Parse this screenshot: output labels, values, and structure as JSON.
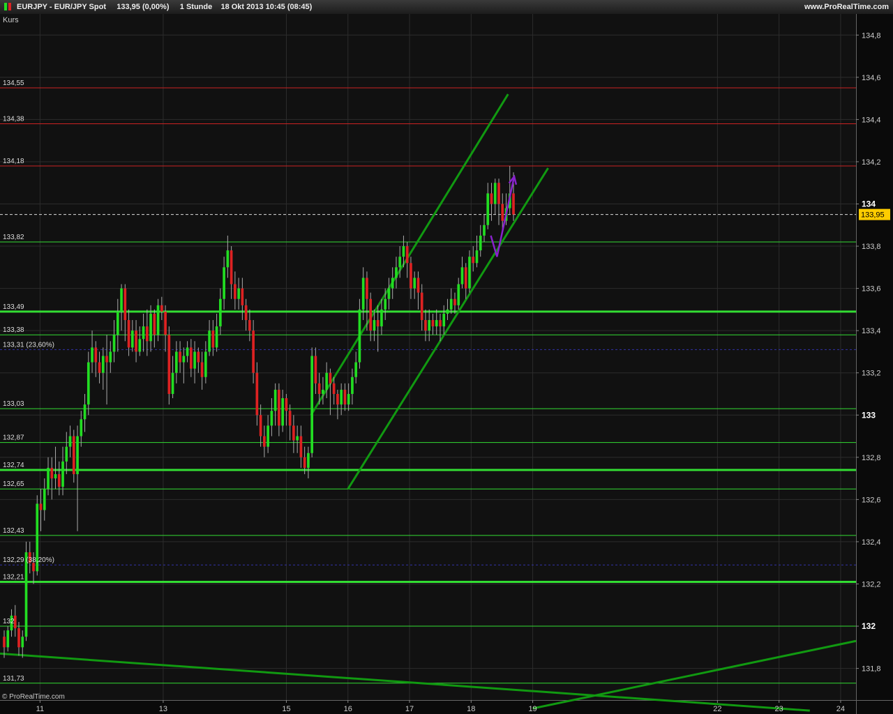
{
  "header": {
    "symbol": "EURJPY",
    "instrument": "EUR/JPY Spot",
    "price": "133,95 (0,00%)",
    "timeframe": "1 Stunde",
    "datetime": "18 Okt 2013 10:45 (08:45)",
    "website": "www.ProRealTime.com"
  },
  "footer": {
    "copyright": "© ProRealTime.com"
  },
  "colors": {
    "background": "#111111",
    "up_candle": "#22dd22",
    "down_candle": "#dd2222",
    "resistance_line": "#cc2222",
    "support_line": "#33dd33",
    "channel_line": "#119911",
    "fib_line": "#3333aa",
    "forecast_arrow": "#8822cc",
    "price_marker": "#ffcc00"
  },
  "chart_data": {
    "type": "candlestick",
    "panel_label": "Kurs",
    "ylim": [
      131.65,
      134.9
    ],
    "xlim": [
      10.35,
      24.25
    ],
    "y_ticks": [
      {
        "value": 131.8,
        "label": "131,8",
        "bold": false
      },
      {
        "value": 132.0,
        "label": "132",
        "bold": true
      },
      {
        "value": 132.2,
        "label": "132,2",
        "bold": false
      },
      {
        "value": 132.4,
        "label": "132,4",
        "bold": false
      },
      {
        "value": 132.6,
        "label": "132,6",
        "bold": false
      },
      {
        "value": 132.8,
        "label": "132,8",
        "bold": false
      },
      {
        "value": 133.0,
        "label": "133",
        "bold": true
      },
      {
        "value": 133.2,
        "label": "133,2",
        "bold": false
      },
      {
        "value": 133.4,
        "label": "133,4",
        "bold": false
      },
      {
        "value": 133.6,
        "label": "133,6",
        "bold": false
      },
      {
        "value": 133.8,
        "label": "133,8",
        "bold": false
      },
      {
        "value": 134.0,
        "label": "134",
        "bold": true
      },
      {
        "value": 134.2,
        "label": "134,2",
        "bold": false
      },
      {
        "value": 134.4,
        "label": "134,4",
        "bold": false
      },
      {
        "value": 134.6,
        "label": "134,6",
        "bold": false
      },
      {
        "value": 134.8,
        "label": "134,8",
        "bold": false
      }
    ],
    "x_ticks": [
      {
        "value": 11,
        "label": "11"
      },
      {
        "value": 13,
        "label": "13"
      },
      {
        "value": 15,
        "label": "15"
      },
      {
        "value": 16,
        "label": "16"
      },
      {
        "value": 17,
        "label": "17"
      },
      {
        "value": 18,
        "label": "18"
      },
      {
        "value": 19,
        "label": "19"
      },
      {
        "value": 22,
        "label": "22"
      },
      {
        "value": 23,
        "label": "23"
      },
      {
        "value": 24,
        "label": "24"
      }
    ],
    "last_price": {
      "value": 133.95,
      "label": "133,95"
    },
    "levels": [
      {
        "value": 134.55,
        "label": "134,55",
        "kind": "resistance",
        "thick": false
      },
      {
        "value": 134.38,
        "label": "134,38",
        "kind": "resistance",
        "thick": false
      },
      {
        "value": 134.18,
        "label": "134,18",
        "kind": "resistance",
        "thick": false
      },
      {
        "value": 133.82,
        "label": "133,82",
        "kind": "support",
        "thick": false
      },
      {
        "value": 133.49,
        "label": "133,49",
        "kind": "support",
        "thick": true
      },
      {
        "value": 133.38,
        "label": "133,38",
        "kind": "support",
        "thick": false
      },
      {
        "value": 133.31,
        "label": "133,31 (23,60%)",
        "kind": "fib",
        "thick": false
      },
      {
        "value": 133.03,
        "label": "133,03",
        "kind": "support",
        "thick": false
      },
      {
        "value": 132.87,
        "label": "132,87",
        "kind": "support",
        "thick": false
      },
      {
        "value": 132.74,
        "label": "132,74",
        "kind": "support",
        "thick": true
      },
      {
        "value": 132.65,
        "label": "132,65",
        "kind": "support",
        "thick": false
      },
      {
        "value": 132.43,
        "label": "132,43",
        "kind": "support",
        "thick": false
      },
      {
        "value": 132.29,
        "label": "132,29 (38,20%)",
        "kind": "fib",
        "thick": false
      },
      {
        "value": 132.21,
        "label": "132,21",
        "kind": "support",
        "thick": true
      },
      {
        "value": 132.0,
        "label": "132",
        "kind": "support",
        "thick": false
      },
      {
        "value": 131.73,
        "label": "131,73",
        "kind": "support",
        "thick": false
      }
    ],
    "trendlines": [
      {
        "x1": 15.4,
        "y1": 133.0,
        "x2": 18.6,
        "y2": 134.52
      },
      {
        "x1": 16.0,
        "y1": 132.65,
        "x2": 19.25,
        "y2": 134.17
      },
      {
        "x1": 10.35,
        "y1": 131.87,
        "x2": 23.5,
        "y2": 131.6
      },
      {
        "x1": 19.0,
        "y1": 131.61,
        "x2": 24.25,
        "y2": 131.93
      }
    ],
    "forecast": [
      [
        18.32,
        133.85
      ],
      [
        18.42,
        133.75
      ],
      [
        18.7,
        134.13
      ]
    ],
    "candles": [
      [
        131.95,
        131.9,
        131.98,
        131.85
      ],
      [
        131.9,
        131.98,
        132.0,
        131.88
      ],
      [
        131.98,
        132.05,
        132.08,
        131.95
      ],
      [
        132.05,
        131.99,
        132.1,
        131.95
      ],
      [
        131.99,
        131.9,
        132.02,
        131.86
      ],
      [
        131.9,
        131.95,
        131.98,
        131.85
      ],
      [
        131.95,
        132.35,
        132.4,
        131.93
      ],
      [
        132.35,
        132.3,
        132.4,
        132.25
      ],
      [
        132.3,
        132.26,
        132.35,
        132.2
      ],
      [
        132.26,
        132.58,
        132.62,
        132.24
      ],
      [
        132.58,
        132.55,
        132.65,
        132.45
      ],
      [
        132.55,
        132.65,
        132.7,
        132.5
      ],
      [
        132.65,
        132.75,
        132.8,
        132.62
      ],
      [
        132.75,
        132.7,
        132.8,
        132.6
      ],
      [
        132.7,
        132.72,
        132.85,
        132.65
      ],
      [
        132.72,
        132.66,
        132.78,
        132.62
      ],
      [
        132.66,
        132.78,
        132.85,
        132.62
      ],
      [
        132.78,
        132.85,
        132.92,
        132.72
      ],
      [
        132.85,
        132.9,
        132.95,
        132.8
      ],
      [
        132.9,
        132.72,
        132.93,
        132.68
      ],
      [
        132.72,
        132.9,
        132.95,
        132.45
      ],
      [
        132.9,
        132.98,
        133.02,
        132.85
      ],
      [
        132.98,
        133.05,
        133.1,
        132.92
      ],
      [
        133.05,
        133.25,
        133.3,
        133.0
      ],
      [
        133.25,
        133.32,
        133.4,
        133.2
      ],
      [
        133.32,
        133.25,
        133.35,
        133.18
      ],
      [
        133.25,
        133.2,
        133.3,
        133.15
      ],
      [
        133.2,
        133.28,
        133.32,
        133.12
      ],
      [
        133.28,
        133.25,
        133.38,
        133.05
      ],
      [
        133.25,
        133.3,
        133.35,
        133.2
      ],
      [
        133.3,
        133.38,
        133.45,
        133.25
      ],
      [
        133.38,
        133.49,
        133.55,
        133.3
      ],
      [
        133.49,
        133.6,
        133.62,
        133.4
      ],
      [
        133.6,
        133.45,
        133.62,
        133.35
      ],
      [
        133.45,
        133.32,
        133.5,
        133.28
      ],
      [
        133.32,
        133.4,
        133.45,
        133.3
      ],
      [
        133.4,
        133.3,
        133.45,
        133.25
      ],
      [
        133.3,
        133.36,
        133.42,
        133.28
      ],
      [
        133.36,
        133.42,
        133.48,
        133.3
      ],
      [
        133.42,
        133.35,
        133.5,
        133.28
      ],
      [
        133.35,
        133.48,
        133.52,
        133.3
      ],
      [
        133.48,
        133.38,
        133.5,
        133.32
      ],
      [
        133.38,
        133.52,
        133.55,
        133.35
      ],
      [
        133.52,
        133.49,
        133.56,
        133.45
      ],
      [
        133.49,
        133.38,
        133.52,
        133.3
      ],
      [
        133.38,
        133.1,
        133.42,
        133.05
      ],
      [
        133.1,
        133.2,
        133.28,
        133.08
      ],
      [
        133.2,
        133.3,
        133.35,
        133.15
      ],
      [
        133.3,
        133.25,
        133.35,
        133.2
      ],
      [
        133.25,
        133.28,
        133.32,
        133.15
      ],
      [
        133.28,
        133.32,
        133.35,
        133.25
      ],
      [
        133.32,
        133.22,
        133.36,
        133.18
      ],
      [
        133.22,
        133.3,
        133.35,
        133.15
      ],
      [
        133.3,
        133.25,
        133.32,
        133.2
      ],
      [
        133.25,
        133.18,
        133.3,
        133.12
      ],
      [
        133.18,
        133.3,
        133.35,
        133.15
      ],
      [
        133.3,
        133.4,
        133.45,
        133.28
      ],
      [
        133.4,
        133.32,
        133.45,
        133.28
      ],
      [
        133.32,
        133.42,
        133.48,
        133.3
      ],
      [
        133.42,
        133.55,
        133.6,
        133.38
      ],
      [
        133.55,
        133.7,
        133.75,
        133.5
      ],
      [
        133.7,
        133.78,
        133.85,
        133.65
      ],
      [
        133.78,
        133.62,
        133.8,
        133.55
      ],
      [
        133.62,
        133.55,
        133.68,
        133.5
      ],
      [
        133.55,
        133.6,
        133.65,
        133.5
      ],
      [
        133.6,
        133.52,
        133.65,
        133.45
      ],
      [
        133.52,
        133.45,
        133.55,
        133.4
      ],
      [
        133.45,
        133.4,
        133.5,
        133.35
      ],
      [
        133.4,
        133.2,
        133.45,
        133.15
      ],
      [
        133.2,
        133.0,
        133.25,
        132.95
      ],
      [
        133.0,
        132.9,
        133.05,
        132.85
      ],
      [
        132.9,
        132.85,
        132.95,
        132.8
      ],
      [
        132.85,
        132.95,
        133.0,
        132.82
      ],
      [
        132.95,
        133.02,
        133.08,
        132.9
      ],
      [
        133.02,
        133.12,
        133.15,
        132.95
      ],
      [
        133.12,
        132.95,
        133.15,
        132.9
      ],
      [
        132.95,
        133.08,
        133.12,
        132.92
      ],
      [
        133.08,
        133.02,
        133.1,
        132.95
      ],
      [
        133.02,
        132.95,
        133.05,
        132.88
      ],
      [
        132.95,
        132.88,
        133.0,
        132.82
      ],
      [
        132.88,
        132.9,
        132.95,
        132.82
      ],
      [
        132.9,
        132.8,
        132.95,
        132.75
      ],
      [
        132.8,
        132.75,
        132.85,
        132.72
      ],
      [
        132.75,
        132.82,
        132.85,
        132.7
      ],
      [
        132.82,
        133.28,
        133.32,
        132.8
      ],
      [
        133.28,
        133.15,
        133.32,
        133.1
      ],
      [
        133.15,
        133.1,
        133.2,
        133.05
      ],
      [
        133.1,
        133.12,
        133.18,
        133.05
      ],
      [
        133.12,
        133.2,
        133.25,
        133.08
      ],
      [
        133.2,
        133.15,
        133.22,
        133.0
      ],
      [
        133.15,
        133.1,
        133.18,
        133.05
      ],
      [
        133.1,
        133.05,
        133.12,
        132.98
      ],
      [
        133.05,
        133.12,
        133.15,
        133.0
      ],
      [
        133.12,
        133.05,
        133.15,
        133.02
      ],
      [
        133.05,
        133.1,
        133.15,
        133.02
      ],
      [
        133.1,
        133.18,
        133.22,
        133.05
      ],
      [
        133.18,
        133.25,
        133.3,
        133.15
      ],
      [
        133.25,
        133.5,
        133.55,
        133.22
      ],
      [
        133.5,
        133.65,
        133.7,
        133.45
      ],
      [
        133.65,
        133.55,
        133.68,
        133.4
      ],
      [
        133.55,
        133.4,
        133.58,
        133.35
      ],
      [
        133.4,
        133.45,
        133.5,
        133.35
      ],
      [
        133.45,
        133.42,
        133.52,
        133.3
      ],
      [
        133.42,
        133.5,
        133.55,
        133.38
      ],
      [
        133.5,
        133.55,
        133.6,
        133.45
      ],
      [
        133.55,
        133.6,
        133.65,
        133.5
      ],
      [
        133.6,
        133.65,
        133.7,
        133.55
      ],
      [
        133.65,
        133.7,
        133.75,
        133.6
      ],
      [
        133.7,
        133.75,
        133.8,
        133.65
      ],
      [
        133.75,
        133.8,
        133.85,
        133.7
      ],
      [
        133.8,
        133.72,
        133.82,
        133.65
      ],
      [
        133.72,
        133.6,
        133.75,
        133.55
      ],
      [
        133.6,
        133.65,
        133.68,
        133.55
      ],
      [
        133.65,
        133.58,
        133.68,
        133.5
      ],
      [
        133.58,
        133.45,
        133.62,
        133.4
      ],
      [
        133.45,
        133.4,
        133.5,
        133.35
      ],
      [
        133.4,
        133.45,
        133.5,
        133.35
      ],
      [
        133.45,
        133.42,
        133.48,
        133.38
      ],
      [
        133.42,
        133.45,
        133.5,
        133.38
      ],
      [
        133.45,
        133.42,
        133.48,
        133.35
      ],
      [
        133.42,
        133.48,
        133.52,
        133.38
      ],
      [
        133.48,
        133.5,
        133.55,
        133.45
      ],
      [
        133.5,
        133.55,
        133.6,
        133.48
      ],
      [
        133.55,
        133.52,
        133.58,
        133.48
      ],
      [
        133.52,
        133.62,
        133.65,
        133.5
      ],
      [
        133.62,
        133.7,
        133.75,
        133.6
      ],
      [
        133.7,
        133.6,
        133.72,
        133.55
      ],
      [
        133.6,
        133.75,
        133.78,
        133.58
      ],
      [
        133.75,
        133.72,
        133.8,
        133.68
      ],
      [
        133.72,
        133.78,
        133.85,
        133.7
      ],
      [
        133.78,
        133.85,
        133.9,
        133.75
      ],
      [
        133.85,
        133.9,
        133.95,
        133.82
      ],
      [
        133.9,
        134.05,
        134.1,
        133.88
      ],
      [
        134.05,
        134.0,
        134.1,
        133.92
      ],
      [
        134.0,
        134.1,
        134.12,
        133.95
      ],
      [
        134.1,
        134.0,
        134.12,
        133.9
      ],
      [
        134.0,
        133.92,
        134.05,
        133.88
      ],
      [
        133.92,
        133.98,
        134.05,
        133.9
      ],
      [
        133.98,
        134.05,
        134.18,
        133.95
      ],
      [
        134.05,
        133.95,
        134.15,
        133.92
      ]
    ]
  }
}
